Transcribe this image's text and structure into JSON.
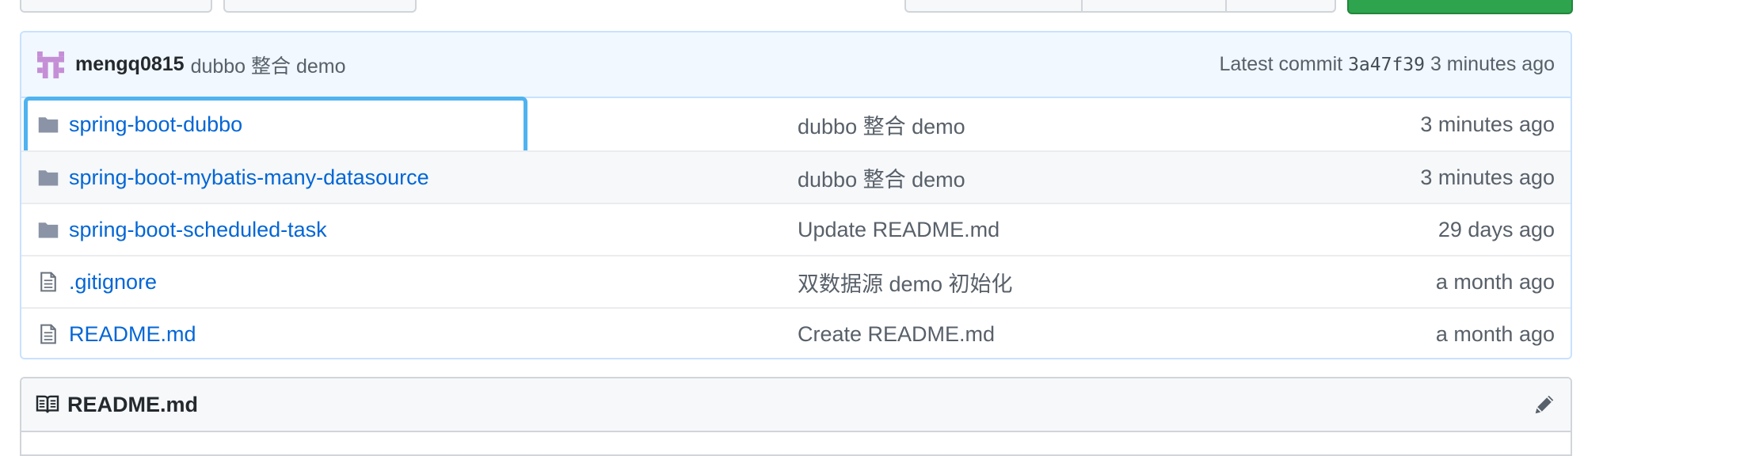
{
  "last_commit": {
    "author": "mengq0815",
    "message": "dubbo 整合 demo",
    "latest_label": "Latest commit",
    "sha": "3a47f39",
    "time": "3 minutes ago"
  },
  "files": [
    {
      "type": "folder",
      "name": "spring-boot-dubbo",
      "commit": "dubbo 整合 demo",
      "age": "3 minutes ago"
    },
    {
      "type": "folder",
      "name": "spring-boot-mybatis-many-datasource",
      "commit": "dubbo 整合 demo",
      "age": "3 minutes ago"
    },
    {
      "type": "folder",
      "name": "spring-boot-scheduled-task",
      "commit": "Update README.md",
      "age": "29 days ago"
    },
    {
      "type": "file",
      "name": ".gitignore",
      "commit": "双数据源 demo 初始化",
      "age": "a month ago"
    },
    {
      "type": "file",
      "name": "README.md",
      "commit": "Create README.md",
      "age": "a month ago"
    }
  ],
  "readme": {
    "title": "README.md"
  },
  "icons": {
    "folder": "folder-icon",
    "file": "file-icon",
    "book": "book-icon",
    "edit": "pencil-icon",
    "avatar": "identicon-avatar"
  },
  "colors": {
    "link": "#0366d6",
    "focus_ring": "#4fb3f0",
    "commit_bar_bg": "#f1f8ff",
    "clone_button": "#2ea44f",
    "avatar": "#c58fd6"
  }
}
